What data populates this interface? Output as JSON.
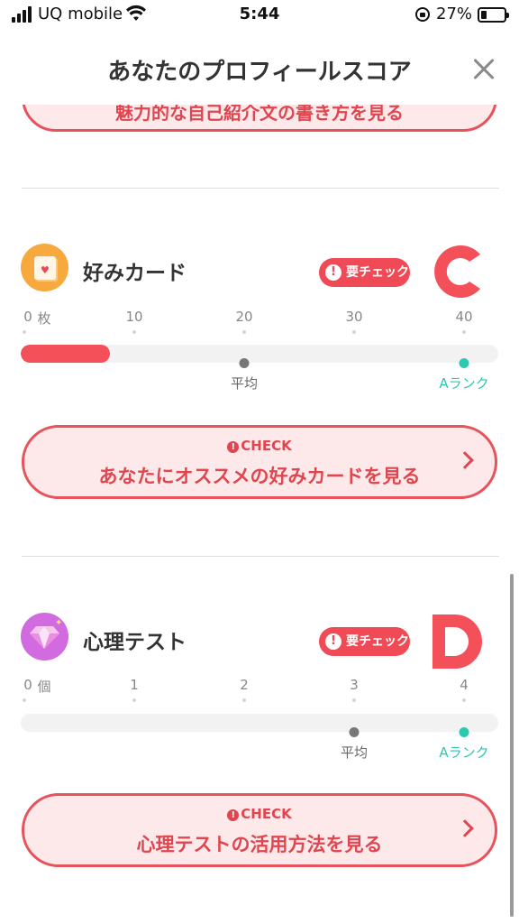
{
  "status_bar": {
    "carrier": "UQ mobile",
    "time": "5:44",
    "battery": "27%",
    "battery_level": 0.27
  },
  "header": {
    "title": "あなたのプロフィールスコア"
  },
  "partial_button": {
    "label": "魅力的な自己紹介文の書き方を見る"
  },
  "sections": [
    {
      "title": "好みカード",
      "icon": "card-heart-icon",
      "badge": "要チェック",
      "grade": "C",
      "grade_color": "#f4505a",
      "unit": "枚",
      "ticks": [
        "0",
        "10",
        "20",
        "30",
        "40"
      ],
      "current": 7.5,
      "average": 20,
      "a_rank": 40,
      "max": 40,
      "average_label": "平均",
      "a_rank_label": "Aランク",
      "cta_check": "CHECK",
      "cta_label": "あなたにオススメの好みカードを見る"
    },
    {
      "title": "心理テスト",
      "icon": "diamond-icon",
      "badge": "要チェック",
      "grade": "D",
      "grade_color": "#f4505a",
      "unit": "個",
      "ticks": [
        "0",
        "1",
        "2",
        "3",
        "4"
      ],
      "current": 0,
      "average": 3,
      "a_rank": 4,
      "max": 4,
      "average_label": "平均",
      "a_rank_label": "Aランク",
      "cta_check": "CHECK",
      "cta_label": "心理テストの活用方法を見る"
    }
  ],
  "colors": {
    "accent": "#e8525a",
    "accent_bg": "#fde9ea",
    "a_rank": "#2cc9b0",
    "average_marker": "#777777"
  }
}
